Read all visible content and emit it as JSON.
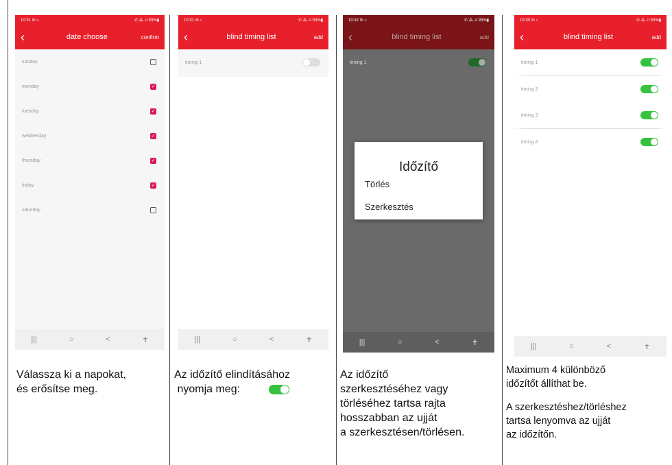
{
  "panels": {
    "p1": {
      "status": {
        "time": "10:31 ✉ ⌂",
        "right": "✆ ⁂ .ıl 93%▮"
      },
      "title": "date choose",
      "action": "confirm",
      "days": [
        {
          "label": "sunday",
          "checked": false
        },
        {
          "label": "monday",
          "checked": true
        },
        {
          "label": "tuesday",
          "checked": true
        },
        {
          "label": "wednesday",
          "checked": true
        },
        {
          "label": "thursday",
          "checked": true
        },
        {
          "label": "friday",
          "checked": true
        },
        {
          "label": "saturday",
          "checked": false
        }
      ],
      "caption_lines": [
        "Válassza ki a napokat,",
        "és erősítse meg."
      ]
    },
    "p2": {
      "status": {
        "time": "10:31 ✉ ⌂",
        "right": "✆ ⁂ .ıl 93%▮"
      },
      "title": "blind timing list",
      "action": "add",
      "item": "timing 1",
      "caption_lines": [
        "Az időzítő elindításához",
        " nyomja meg:"
      ]
    },
    "p3": {
      "status": {
        "time": "10:32 ✉ ⌂",
        "right": "✆ ⁂ .ıl 93%▮"
      },
      "title": "blind timing list",
      "action": "add",
      "item": "timing 1",
      "dialog": {
        "title": "Időzítő",
        "delete": "Törlés",
        "edit": "Szerkesztés"
      },
      "caption_lines": [
        "Az időzítő",
        "szerkesztéséhez vagy",
        "törléséhez tartsa rajta",
        "hosszabban az ujját",
        "a szerkesztésen/törlésen."
      ]
    },
    "p4": {
      "status": {
        "time": "10:30 ✉ ⌂",
        "right": "✆ ⁂ .ıl 93%▮"
      },
      "title": "blind timing list",
      "action": "add",
      "items": [
        "timing 1",
        "timing 2",
        "timing 3",
        "timing 4"
      ],
      "caption_lines": [
        "Maximum 4 különböző",
        "időzítőt állíthat be.",
        "",
        "A szerkesztéshez/törléshez",
        "tartsa lenyomva az ujját",
        "az időzítőn."
      ]
    }
  },
  "navbar": {
    "recent": "|||",
    "home": "○",
    "back": "<",
    "accessibility": "✝"
  },
  "icons": {
    "back": "chevron-left",
    "check": "✓"
  }
}
